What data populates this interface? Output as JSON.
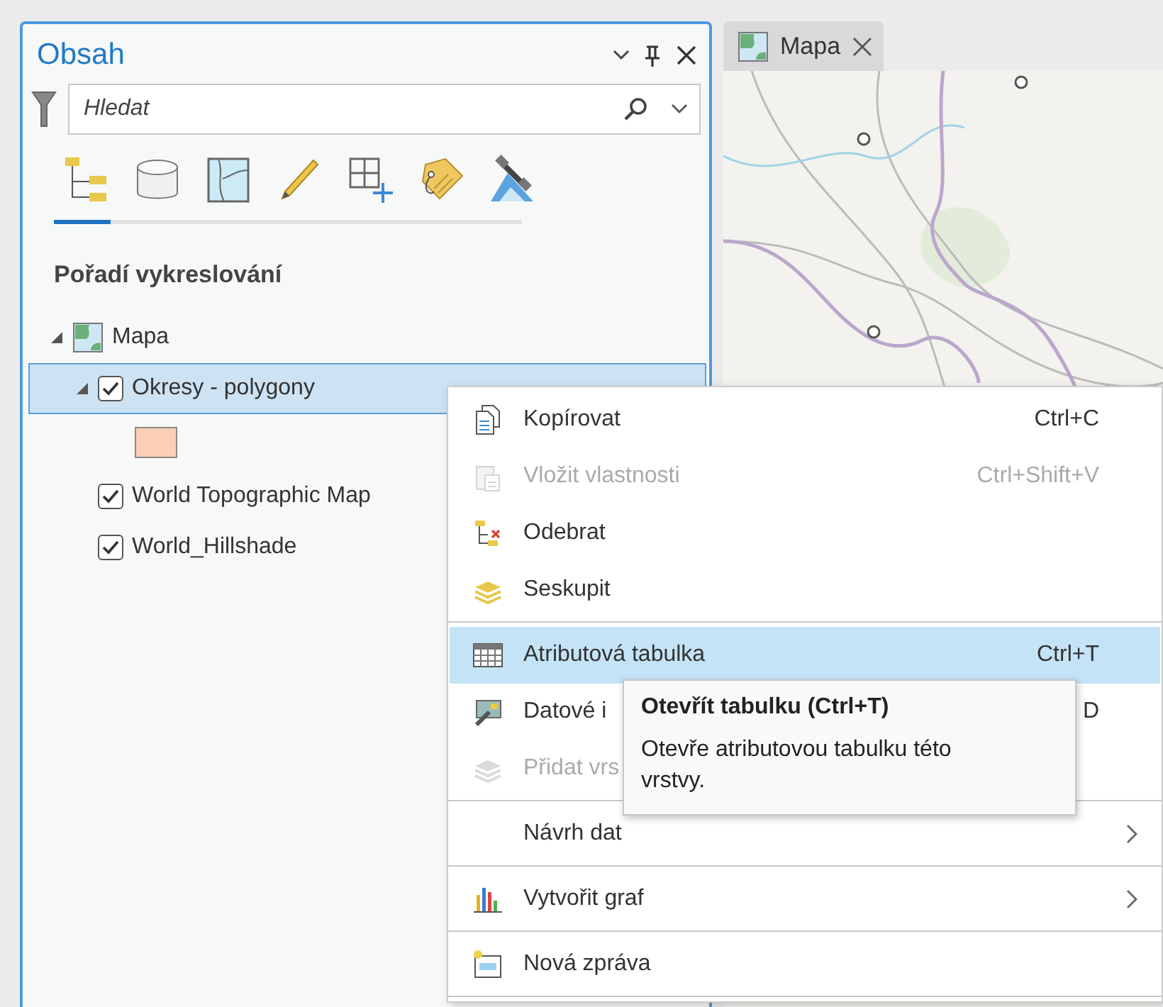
{
  "contents_pane": {
    "title": "Obsah",
    "search": {
      "placeholder": "Hledat"
    },
    "view_tabs": [
      {
        "kind": "drawing_order",
        "selected": true
      },
      {
        "kind": "source",
        "selected": false
      },
      {
        "kind": "selection",
        "selected": false
      },
      {
        "kind": "editing",
        "selected": false
      },
      {
        "kind": "snapping",
        "selected": false
      },
      {
        "kind": "labeling",
        "selected": false
      },
      {
        "kind": "perspective",
        "selected": false
      }
    ],
    "heading": "Pořadí vykreslování",
    "tree": [
      {
        "kind": "map",
        "label": "Mapa",
        "expanded": true,
        "selected": false,
        "children": [
          {
            "kind": "layer",
            "label": "Okresy - polygony",
            "checked": true,
            "selected": true,
            "expanded": true,
            "children": [
              {
                "kind": "symbol",
                "color": "#fdcfb6"
              }
            ]
          },
          {
            "kind": "layer",
            "label": "World Topographic Map",
            "checked": true,
            "selected": false
          },
          {
            "kind": "layer",
            "label": "World_Hillshade",
            "checked": true,
            "selected": false
          }
        ]
      }
    ]
  },
  "tabs": [
    {
      "label": "Mapa",
      "selected": true
    }
  ],
  "context_menu": {
    "items": [
      {
        "kind": "copy",
        "label": "Kopírovat",
        "shortcut": "Ctrl+C",
        "disabled": false,
        "selected": false,
        "submenu": false
      },
      {
        "kind": "paste",
        "label": "Vložit vlastnosti",
        "shortcut": "Ctrl+Shift+V",
        "disabled": true,
        "selected": false,
        "submenu": false
      },
      {
        "kind": "remove",
        "label": "Odebrat",
        "disabled": false,
        "selected": false,
        "submenu": false
      },
      {
        "kind": "group",
        "label": "Seskupit",
        "disabled": false,
        "selected": false,
        "submenu": false
      },
      {
        "kind": "separator"
      },
      {
        "kind": "table",
        "label": "Atributová tabulka",
        "shortcut": "Ctrl+T",
        "disabled": false,
        "selected": true,
        "submenu": false
      },
      {
        "kind": "data",
        "label": "Datové i",
        "shortcut": "D",
        "disabled": false,
        "selected": false,
        "submenu": false
      },
      {
        "kind": "layers",
        "label": "Přidat vrs",
        "disabled": true,
        "selected": false,
        "submenu": false
      },
      {
        "kind": "separator"
      },
      {
        "kind": "plain",
        "label": "Návrh dat",
        "disabled": false,
        "selected": false,
        "submenu": true
      },
      {
        "kind": "separator"
      },
      {
        "kind": "chart",
        "label": "Vytvořit graf",
        "disabled": false,
        "selected": false,
        "submenu": true
      },
      {
        "kind": "separator"
      },
      {
        "kind": "report",
        "label": "Nová zpráva",
        "disabled": false,
        "selected": false,
        "submenu": false
      },
      {
        "kind": "separator"
      }
    ]
  },
  "tooltip": {
    "title": "Otevřít tabulku (Ctrl+T)",
    "text": "Otevře atributovou tabulku této vrstvy."
  }
}
